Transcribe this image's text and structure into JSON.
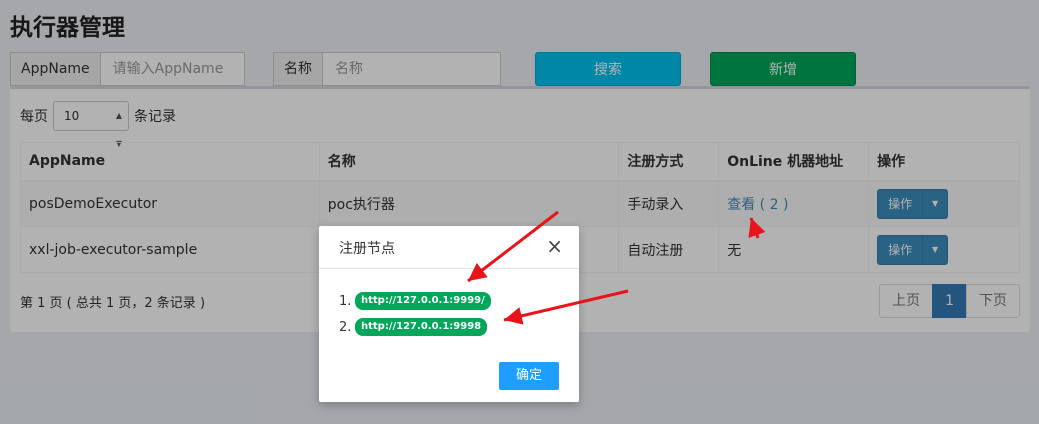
{
  "page": {
    "title": "执行器管理"
  },
  "filters": {
    "appname_label": "AppName",
    "appname_placeholder": "请输入AppName",
    "title_label": "名称",
    "title_placeholder": "名称",
    "search_button": "搜索",
    "add_button": "新增"
  },
  "list": {
    "per_page_label": "每页",
    "per_page_value": "10",
    "per_page_suffix": "条记录",
    "columns": [
      "AppName",
      "名称",
      "注册方式",
      "OnLine 机器地址",
      "操作"
    ],
    "rows": [
      {
        "appname": "posDemoExecutor",
        "title": "poc执行器",
        "reg_type": "手动录入",
        "online": "查看 ( 2 )",
        "op": "操作"
      },
      {
        "appname": "xxl-job-executor-sample",
        "title": "",
        "reg_type": "自动注册",
        "online": "无",
        "op": "操作"
      }
    ],
    "summary": "第 1 页 ( 总共 1 页，2 条记录 )",
    "pager": {
      "prev": "上页",
      "current": "1",
      "next": "下页"
    }
  },
  "modal": {
    "title": "注册节点",
    "close": "×",
    "nodes": [
      {
        "index": "1.",
        "address": "http://127.0.0.1:9999/"
      },
      {
        "index": "2.",
        "address": "http://127.0.0.1:9998"
      }
    ],
    "ok_button": "确定"
  },
  "colors": {
    "search": "#00c0ef",
    "add": "#00a65a",
    "primary": "#3c8dbc",
    "pill": "#00a65a",
    "ok": "#1e9fff",
    "arrow": "#e8141b"
  }
}
